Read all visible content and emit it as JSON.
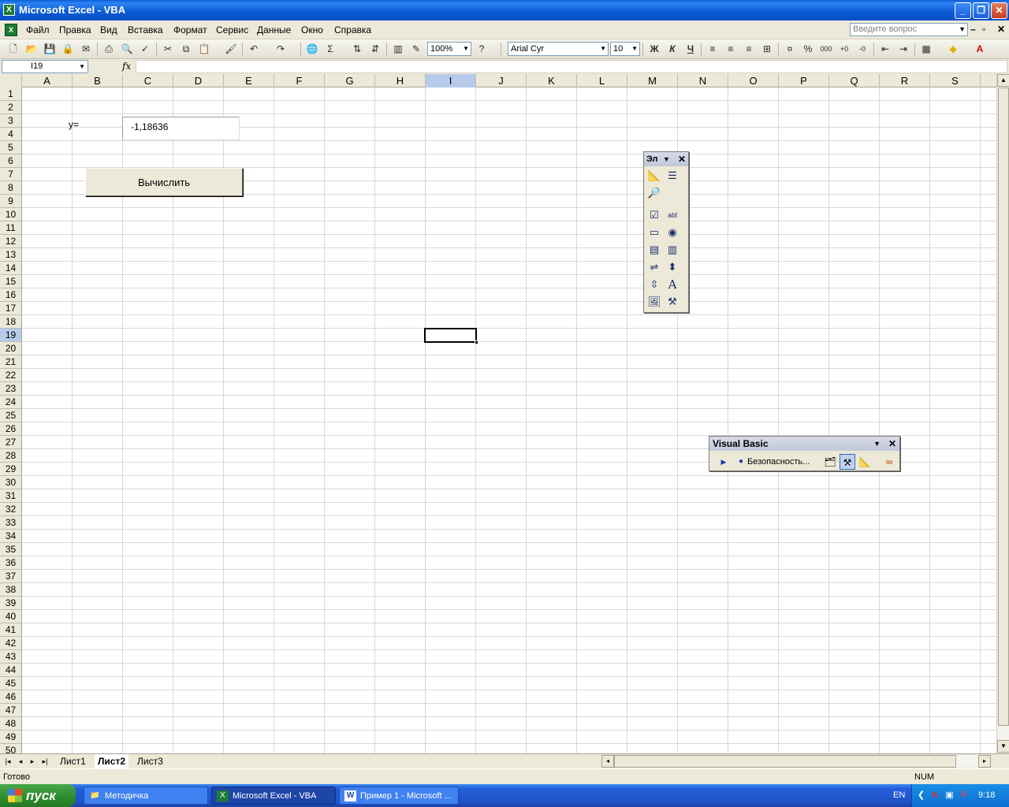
{
  "window": {
    "title": "Microsoft Excel - VBA"
  },
  "menu": {
    "items": [
      "Файл",
      "Правка",
      "Вид",
      "Вставка",
      "Формат",
      "Сервис",
      "Данные",
      "Окно",
      "Справка"
    ],
    "ask_placeholder": "Введите вопрос"
  },
  "toolbar": {
    "zoom": "100%",
    "font": "Arial Cyr",
    "font_size": "10",
    "bold_label": "Ж",
    "italic_label": "К",
    "underline_label": "Ч"
  },
  "formula_bar": {
    "name_box": "I19",
    "fx_label": "fx",
    "formula": ""
  },
  "grid": {
    "columns": [
      "A",
      "B",
      "C",
      "D",
      "E",
      "F",
      "G",
      "H",
      "I",
      "J",
      "K",
      "L",
      "M",
      "N",
      "O",
      "P",
      "Q",
      "R",
      "S"
    ],
    "rows": [
      "1",
      "2",
      "3",
      "4",
      "5",
      "6",
      "7",
      "8",
      "9",
      "10",
      "11",
      "12",
      "13",
      "14",
      "15",
      "16",
      "17",
      "18",
      "19",
      "20",
      "21",
      "22",
      "23",
      "24",
      "25",
      "26",
      "27",
      "28",
      "29",
      "30",
      "31",
      "32",
      "33",
      "34",
      "35",
      "36",
      "37",
      "38",
      "39",
      "40",
      "41",
      "42",
      "43",
      "44",
      "45",
      "46",
      "47",
      "48",
      "49",
      "50"
    ],
    "selected_column": "I",
    "selected_row": "19"
  },
  "sheet_objects": {
    "y_label": "y=",
    "result_value": "-1,18636",
    "button_label": "Вычислить"
  },
  "controls_toolbar": {
    "title": "Эл"
  },
  "vb_toolbar": {
    "title": "Visual Basic",
    "security_label": "Безопасность..."
  },
  "sheet_tabs": {
    "tabs": [
      "Лист1",
      "Лист2",
      "Лист3"
    ],
    "active": "Лист2"
  },
  "status": {
    "ready": "Готово",
    "num": "NUM"
  },
  "taskbar": {
    "start_label": "пуск",
    "tasks": [
      "Методичка",
      "Microsoft Excel - VBA",
      "Пример 1 - Microsoft ..."
    ],
    "lang": "EN",
    "clock": "9:18"
  }
}
